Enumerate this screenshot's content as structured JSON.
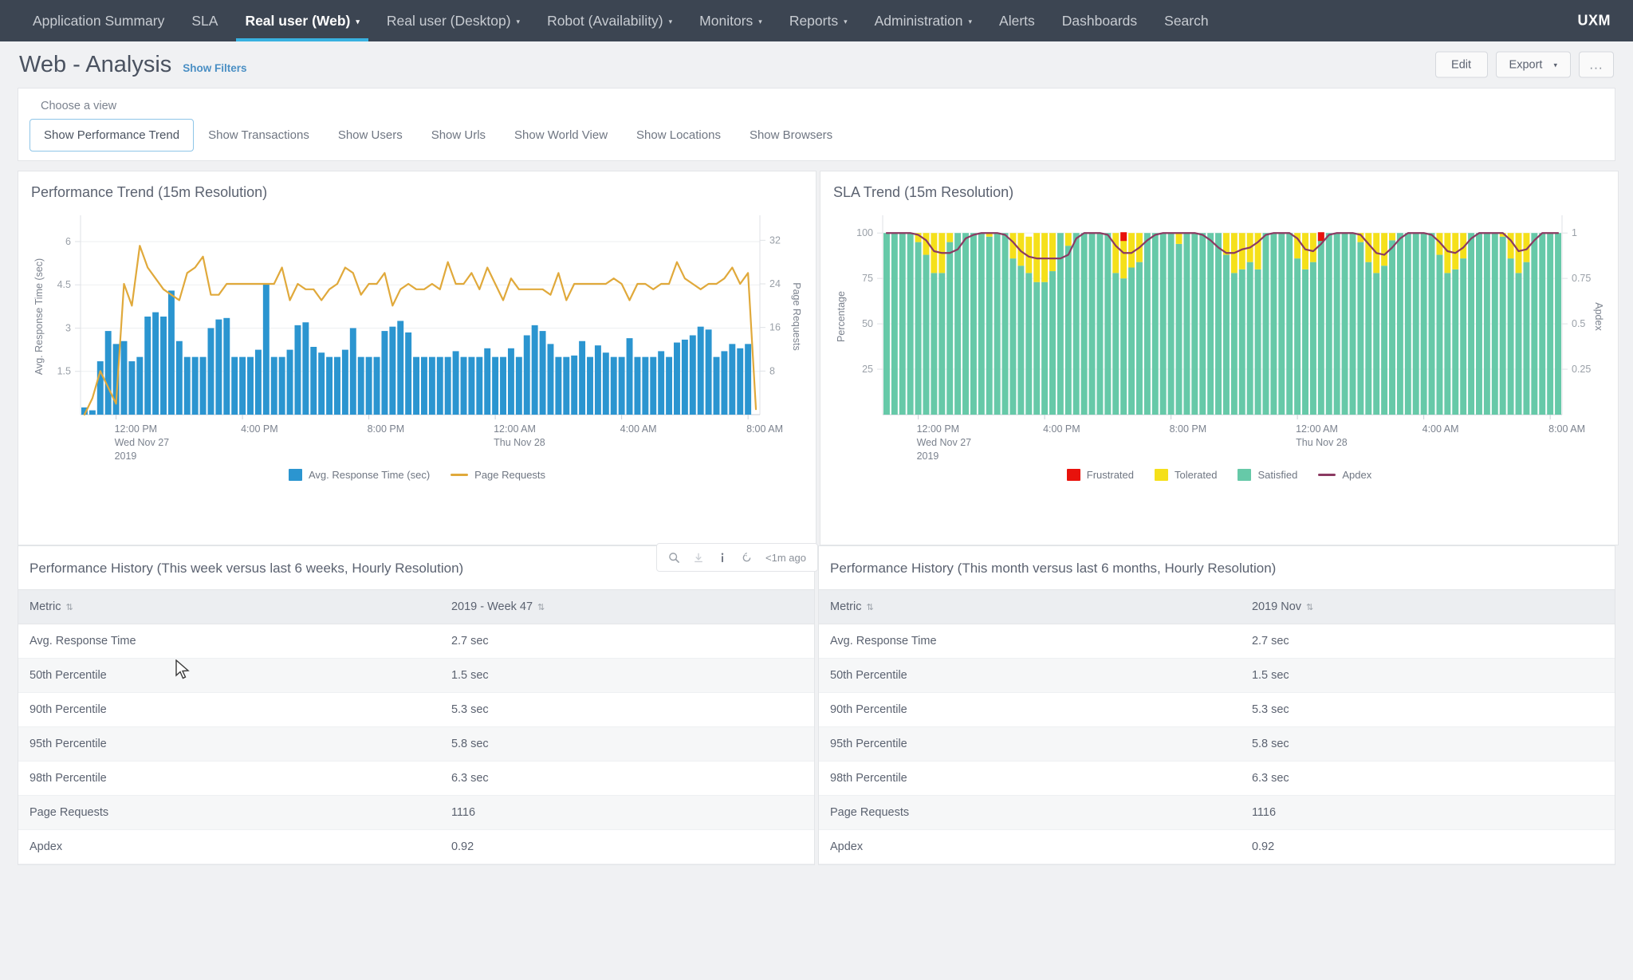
{
  "topnav": {
    "items": [
      {
        "label": "Application Summary",
        "caret": false,
        "active": false
      },
      {
        "label": "SLA",
        "caret": false,
        "active": false
      },
      {
        "label": "Real user (Web)",
        "caret": true,
        "active": true
      },
      {
        "label": "Real user (Desktop)",
        "caret": true,
        "active": false
      },
      {
        "label": "Robot (Availability)",
        "caret": true,
        "active": false
      },
      {
        "label": "Monitors",
        "caret": true,
        "active": false
      },
      {
        "label": "Reports",
        "caret": true,
        "active": false
      },
      {
        "label": "Administration",
        "caret": true,
        "active": false
      },
      {
        "label": "Alerts",
        "caret": false,
        "active": false
      },
      {
        "label": "Dashboards",
        "caret": false,
        "active": false
      },
      {
        "label": "Search",
        "caret": false,
        "active": false
      }
    ],
    "brand": "UXM",
    "caret_glyph": "▾"
  },
  "header": {
    "title": "Web - Analysis",
    "show_filters": "Show Filters",
    "edit_label": "Edit",
    "export_label": "Export",
    "export_caret": "▾",
    "more_label": "..."
  },
  "viewchooser": {
    "label": "Choose a view",
    "tabs": [
      {
        "label": "Show Performance Trend",
        "active": true
      },
      {
        "label": "Show Transactions",
        "active": false
      },
      {
        "label": "Show Users",
        "active": false
      },
      {
        "label": "Show Urls",
        "active": false
      },
      {
        "label": "Show World View",
        "active": false
      },
      {
        "label": "Show Locations",
        "active": false
      },
      {
        "label": "Show Browsers",
        "active": false
      }
    ]
  },
  "chart_toolbar": {
    "search_icon": "search-icon",
    "download_icon": "download-icon",
    "info_icon": "info-icon",
    "refresh_icon": "refresh-icon",
    "ago": "<1m ago"
  },
  "tables": [
    {
      "title": "Performance History (This week versus last 6 weeks, Hourly Resolution)",
      "columns": [
        "Metric",
        "2019 - Week 47"
      ],
      "sort_glyph": "⇅",
      "rows": [
        [
          "Avg. Response Time",
          "2.7 sec"
        ],
        [
          "50th Percentile",
          "1.5 sec"
        ],
        [
          "90th Percentile",
          "5.3 sec"
        ],
        [
          "95th Percentile",
          "5.8 sec"
        ],
        [
          "98th Percentile",
          "6.3 sec"
        ],
        [
          "Page Requests",
          "1116"
        ],
        [
          "Apdex",
          "0.92"
        ]
      ]
    },
    {
      "title": "Performance History (This month versus last 6 months, Hourly Resolution)",
      "columns": [
        "Metric",
        "2019 Nov"
      ],
      "sort_glyph": "⇅",
      "rows": [
        [
          "Avg. Response Time",
          "2.7 sec"
        ],
        [
          "50th Percentile",
          "1.5 sec"
        ],
        [
          "90th Percentile",
          "5.3 sec"
        ],
        [
          "95th Percentile",
          "5.8 sec"
        ],
        [
          "98th Percentile",
          "6.3 sec"
        ],
        [
          "Page Requests",
          "1116"
        ],
        [
          "Apdex",
          "0.92"
        ]
      ]
    }
  ],
  "colors": {
    "bar_blue": "#2b95d0",
    "line_orange": "#e0a93b",
    "satisfied": "#66c9a8",
    "tolerated": "#f5e01a",
    "frustrated": "#e8120c",
    "apdex_line": "#8b3a62",
    "nav_bg": "#3c4552",
    "accent": "#38b1e0"
  },
  "chart_data": [
    {
      "type": "bar",
      "title": "Performance Trend (15m Resolution)",
      "xlabel": "",
      "ylabel": "Avg. Response Time (sec)",
      "y2label": "Page Requests",
      "ylim": [
        0,
        6.8
      ],
      "y2lim": [
        0,
        36
      ],
      "yticks": [
        1.5,
        3,
        4.5,
        6
      ],
      "y2ticks": [
        8,
        16,
        24,
        32
      ],
      "grid": true,
      "legend_position": "bottom",
      "xticks": [
        {
          "pos": 4,
          "label": "12:00 PM",
          "sub": "Wed Nov 27",
          "sub2": "2019"
        },
        {
          "pos": 20,
          "label": "4:00 PM",
          "sub": "",
          "sub2": ""
        },
        {
          "pos": 36,
          "label": "8:00 PM",
          "sub": "",
          "sub2": ""
        },
        {
          "pos": 52,
          "label": "12:00 AM",
          "sub": "Thu Nov 28",
          "sub2": ""
        },
        {
          "pos": 68,
          "label": "4:00 AM",
          "sub": "",
          "sub2": ""
        },
        {
          "pos": 84,
          "label": "8:00 AM",
          "sub": "",
          "sub2": ""
        }
      ],
      "series": [
        {
          "name": "Avg. Response Time (sec)",
          "kind": "bar",
          "color": "#2b95d0",
          "axis": "left",
          "values": [
            0.25,
            0.15,
            1.85,
            2.9,
            2.45,
            2.55,
            1.85,
            2.0,
            3.4,
            3.55,
            3.4,
            4.3,
            2.55,
            2.0,
            2.0,
            2.0,
            3.0,
            3.3,
            3.35,
            2.0,
            2.0,
            2.0,
            2.25,
            4.55,
            2.0,
            2.0,
            2.25,
            3.1,
            3.2,
            2.35,
            2.15,
            2.0,
            2.0,
            2.25,
            3.0,
            2.0,
            2.0,
            2.0,
            2.9,
            3.05,
            3.25,
            2.85,
            2.0,
            2.0,
            2.0,
            2.0,
            2.0,
            2.2,
            2.0,
            2.0,
            2.0,
            2.3,
            2.0,
            2.0,
            2.3,
            2.0,
            2.75,
            3.1,
            2.9,
            2.45,
            2.0,
            2.0,
            2.05,
            2.55,
            2.0,
            2.4,
            2.15,
            2.0,
            2.0,
            2.65,
            2.0,
            2.0,
            2.0,
            2.2,
            2.0,
            2.5,
            2.6,
            2.75,
            3.05,
            2.95,
            2.0,
            2.2,
            2.45,
            2.3,
            2.45,
            0.0
          ]
        },
        {
          "name": "Page Requests",
          "kind": "line",
          "color": "#e0a93b",
          "axis": "right",
          "values": [
            0,
            3,
            8,
            5,
            2,
            24,
            20,
            31,
            27,
            25,
            23,
            22,
            21,
            26,
            27,
            29,
            22,
            22,
            24,
            24,
            24,
            24,
            24,
            24,
            24,
            27,
            21,
            24,
            23,
            23,
            21,
            23,
            24,
            27,
            26,
            22,
            24,
            24,
            26,
            20,
            23,
            24,
            23,
            23,
            24,
            23,
            28,
            24,
            24,
            26,
            23,
            27,
            24,
            21,
            25,
            23,
            23,
            23,
            23,
            22,
            26,
            21,
            24,
            24,
            24,
            24,
            24,
            25,
            24,
            21,
            24,
            24,
            23,
            24,
            24,
            28,
            25,
            24,
            23,
            24,
            24,
            25,
            27,
            24,
            26,
            1
          ]
        }
      ]
    },
    {
      "type": "bar",
      "title": "SLA Trend (15m Resolution)",
      "xlabel": "",
      "ylabel": "Percentage",
      "y2label": "Apdex",
      "ylim": [
        0,
        108
      ],
      "y2lim": [
        0,
        1.08
      ],
      "yticks": [
        25,
        50,
        75,
        100
      ],
      "y2ticks": [
        0.25,
        0.5,
        0.75,
        1
      ],
      "grid": true,
      "stacked": true,
      "legend_position": "bottom",
      "xticks": [
        {
          "pos": 4,
          "label": "12:00 PM",
          "sub": "Wed Nov 27",
          "sub2": "2019"
        },
        {
          "pos": 20,
          "label": "4:00 PM",
          "sub": "",
          "sub2": ""
        },
        {
          "pos": 36,
          "label": "8:00 PM",
          "sub": "",
          "sub2": ""
        },
        {
          "pos": 52,
          "label": "12:00 AM",
          "sub": "Thu Nov 28",
          "sub2": ""
        },
        {
          "pos": 68,
          "label": "4:00 AM",
          "sub": "",
          "sub2": ""
        },
        {
          "pos": 84,
          "label": "8:00 AM",
          "sub": "",
          "sub2": ""
        }
      ],
      "series": [
        {
          "name": "Satisfied",
          "kind": "bar",
          "color": "#66c9a8",
          "axis": "left",
          "values": [
            100,
            100,
            100,
            100,
            95,
            88,
            78,
            78,
            95,
            100,
            100,
            100,
            100,
            98,
            100,
            100,
            86,
            82,
            78,
            73,
            73,
            79,
            100,
            93,
            100,
            100,
            100,
            100,
            100,
            78,
            75,
            81,
            84,
            100,
            100,
            100,
            100,
            94,
            100,
            100,
            100,
            100,
            100,
            88,
            78,
            80,
            84,
            80,
            100,
            100,
            100,
            100,
            86,
            80,
            84,
            100,
            100,
            100,
            100,
            100,
            95,
            84,
            78,
            82,
            96,
            100,
            100,
            100,
            100,
            100,
            88,
            78,
            80,
            86,
            100,
            100,
            100,
            100,
            98,
            86,
            78,
            84,
            100,
            100,
            100,
            100
          ]
        },
        {
          "name": "Tolerated",
          "kind": "bar",
          "color": "#f5e01a",
          "axis": "left",
          "values": [
            0,
            0,
            0,
            0,
            5,
            12,
            22,
            22,
            5,
            0,
            0,
            0,
            0,
            2,
            0,
            0,
            14,
            18,
            20,
            27,
            27,
            21,
            0,
            7,
            0,
            0,
            0,
            0,
            0,
            22,
            25,
            19,
            16,
            0,
            0,
            0,
            0,
            6,
            0,
            0,
            0,
            0,
            0,
            12,
            22,
            20,
            16,
            20,
            0,
            0,
            0,
            0,
            14,
            20,
            16,
            0,
            0,
            0,
            0,
            0,
            5,
            16,
            22,
            18,
            4,
            0,
            0,
            0,
            0,
            0,
            12,
            22,
            20,
            14,
            0,
            0,
            0,
            0,
            2,
            14,
            22,
            16,
            0,
            0,
            0,
            0
          ]
        },
        {
          "name": "Frustrated",
          "kind": "bar",
          "color": "#e8120c",
          "axis": "left",
          "values": [
            0,
            0,
            0,
            0,
            0,
            0,
            0,
            0,
            0,
            0,
            0,
            0,
            0,
            0,
            0,
            0,
            0,
            0,
            0,
            0,
            0,
            0,
            0,
            0,
            0,
            0,
            0,
            0,
            0,
            0,
            0,
            0,
            0,
            0,
            0,
            0,
            0,
            0,
            0,
            0,
            0,
            0,
            0,
            0,
            0,
            0,
            0,
            0,
            0,
            0,
            0,
            0,
            0,
            0,
            0,
            0,
            0,
            0,
            0,
            0,
            0,
            0,
            0,
            0,
            0,
            0,
            0,
            0,
            0,
            0,
            0,
            0,
            0,
            0,
            0,
            0,
            0,
            0,
            0,
            0,
            0,
            0,
            0,
            0,
            0,
            0
          ]
        },
        {
          "name": "Apdex",
          "kind": "line",
          "color": "#8b3a62",
          "axis": "right",
          "values": [
            1.0,
            1.0,
            1.0,
            1.0,
            0.99,
            0.96,
            0.9,
            0.89,
            0.89,
            0.91,
            0.97,
            0.99,
            1.0,
            1.0,
            1.0,
            0.99,
            0.95,
            0.9,
            0.87,
            0.86,
            0.86,
            0.86,
            0.86,
            0.88,
            0.97,
            1.0,
            1.0,
            1.0,
            0.99,
            0.93,
            0.89,
            0.89,
            0.92,
            0.96,
            0.99,
            1.0,
            1.0,
            1.0,
            1.0,
            1.0,
            0.99,
            0.96,
            0.92,
            0.89,
            0.89,
            0.91,
            0.92,
            0.95,
            0.99,
            1.0,
            1.0,
            1.0,
            0.97,
            0.91,
            0.9,
            0.94,
            0.99,
            1.0,
            1.0,
            1.0,
            0.99,
            0.94,
            0.89,
            0.88,
            0.92,
            0.97,
            1.0,
            1.0,
            1.0,
            0.99,
            0.95,
            0.9,
            0.89,
            0.92,
            0.97,
            1.0,
            1.0,
            1.0,
            1.0,
            0.96,
            0.9,
            0.91,
            0.96,
            1.0,
            1.0,
            1.0
          ]
        }
      ],
      "frustrated_markers": [
        {
          "index": 30,
          "value": 100
        },
        {
          "index": 55,
          "value": 100
        }
      ]
    }
  ]
}
